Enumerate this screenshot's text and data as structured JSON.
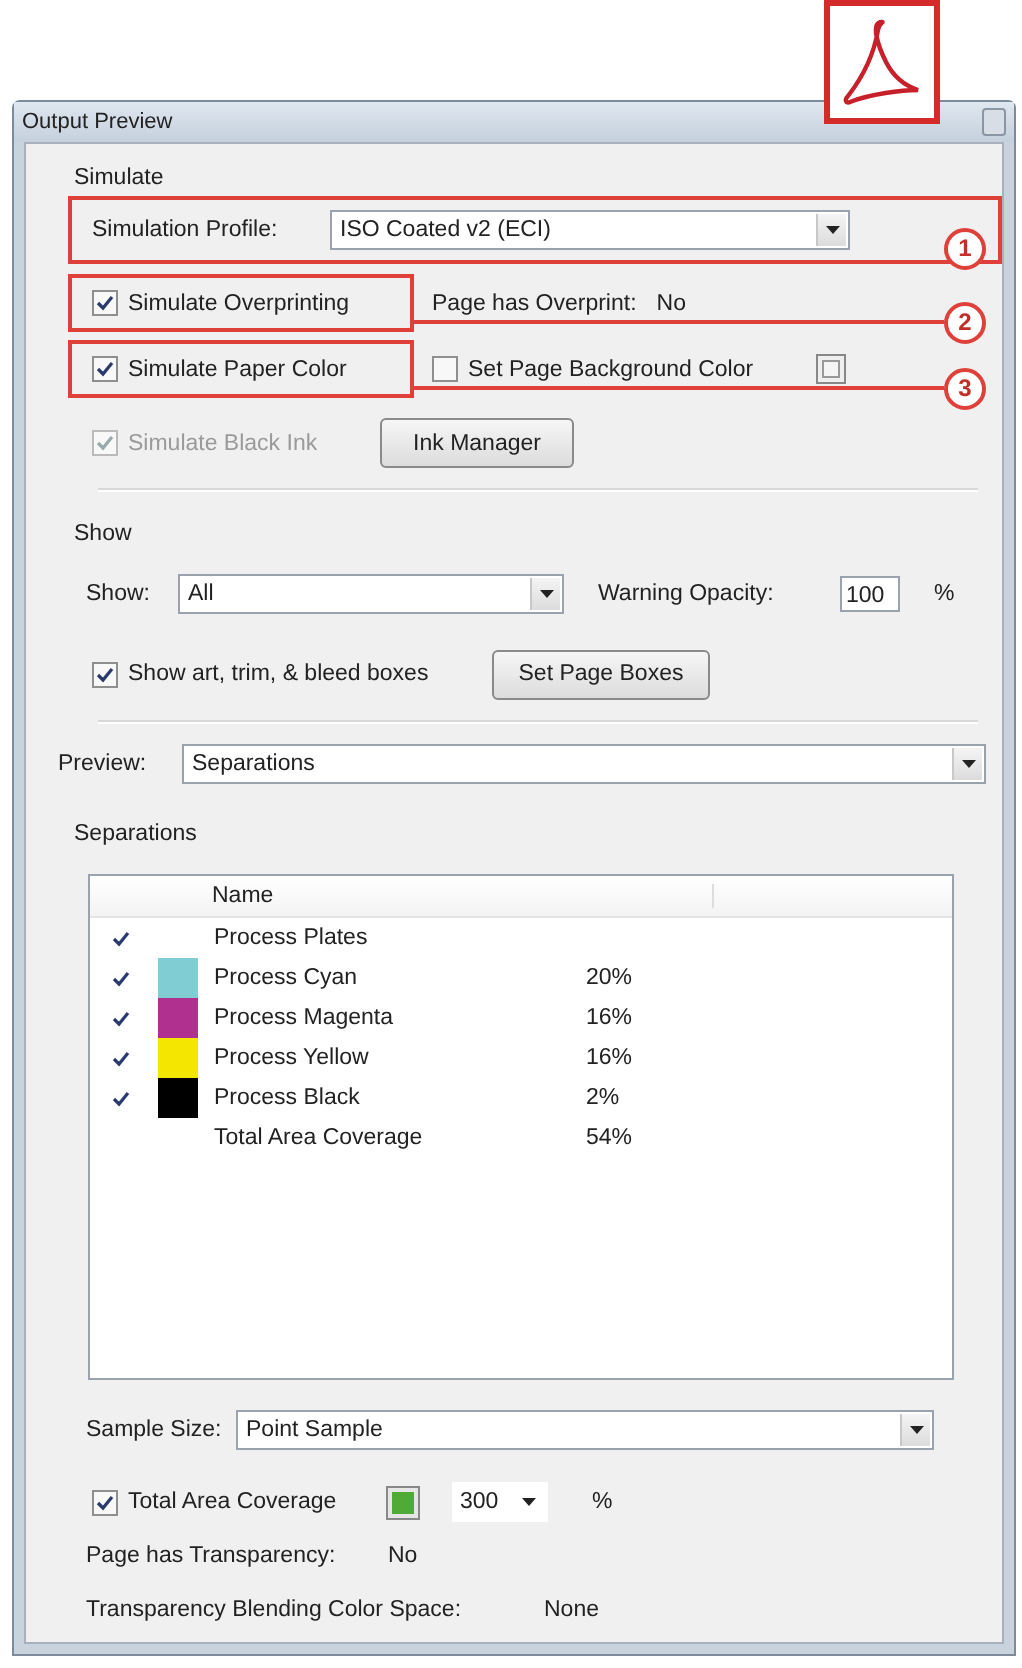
{
  "window": {
    "title": "Output Preview"
  },
  "simulate": {
    "heading": "Simulate",
    "profile": {
      "label": "Simulation Profile:",
      "value": "ISO Coated v2 (ECI)",
      "callout": "1"
    },
    "overprinting": {
      "label": "Simulate Overprinting",
      "checked": true,
      "callout": "2"
    },
    "overprint_status": {
      "label": "Page has Overprint:",
      "value": "No"
    },
    "paper_color": {
      "label": "Simulate Paper Color",
      "checked": true,
      "callout": "3"
    },
    "page_background": {
      "label": "Set Page Background Color",
      "checked": false
    },
    "black_ink": {
      "label": "Simulate Black Ink",
      "checked": true,
      "disabled": true
    },
    "ink_manager_button": "Ink Manager"
  },
  "show": {
    "heading": "Show",
    "show_label": "Show:",
    "show_value": "All",
    "warning_label": "Warning Opacity:",
    "warning_value": "100",
    "warning_unit": "%",
    "boxes": {
      "label": "Show art, trim, & bleed boxes",
      "checked": true
    },
    "page_boxes_button": "Set Page Boxes"
  },
  "preview": {
    "label": "Preview:",
    "value": "Separations"
  },
  "separations": {
    "heading": "Separations",
    "columns": [
      "Name"
    ],
    "rows": [
      {
        "kind": "plate",
        "name": "Process Plates",
        "checked": true
      },
      {
        "kind": "plate",
        "name": "Process Cyan",
        "checked": true,
        "color": "#80cdd3",
        "coverage": "20%"
      },
      {
        "kind": "plate",
        "name": "Process Magenta",
        "checked": true,
        "color": "#b0308f",
        "coverage": "16%"
      },
      {
        "kind": "plate",
        "name": "Process Yellow",
        "checked": true,
        "color": "#f5e600",
        "coverage": "16%"
      },
      {
        "kind": "plate",
        "name": "Process Black",
        "checked": true,
        "color": "#000000",
        "coverage": "2%"
      },
      {
        "kind": "total",
        "name": "Total Area Coverage",
        "coverage": "54%"
      }
    ]
  },
  "sample_size": {
    "label": "Sample Size:",
    "value": "Point Sample"
  },
  "total_coverage": {
    "label": "Total Area Coverage",
    "checked": true,
    "value": "300",
    "unit": "%"
  },
  "info": [
    {
      "label": "Page has Transparency:",
      "value": "No"
    },
    {
      "label": "Transparency Blending Color Space:",
      "value": "None"
    }
  ]
}
